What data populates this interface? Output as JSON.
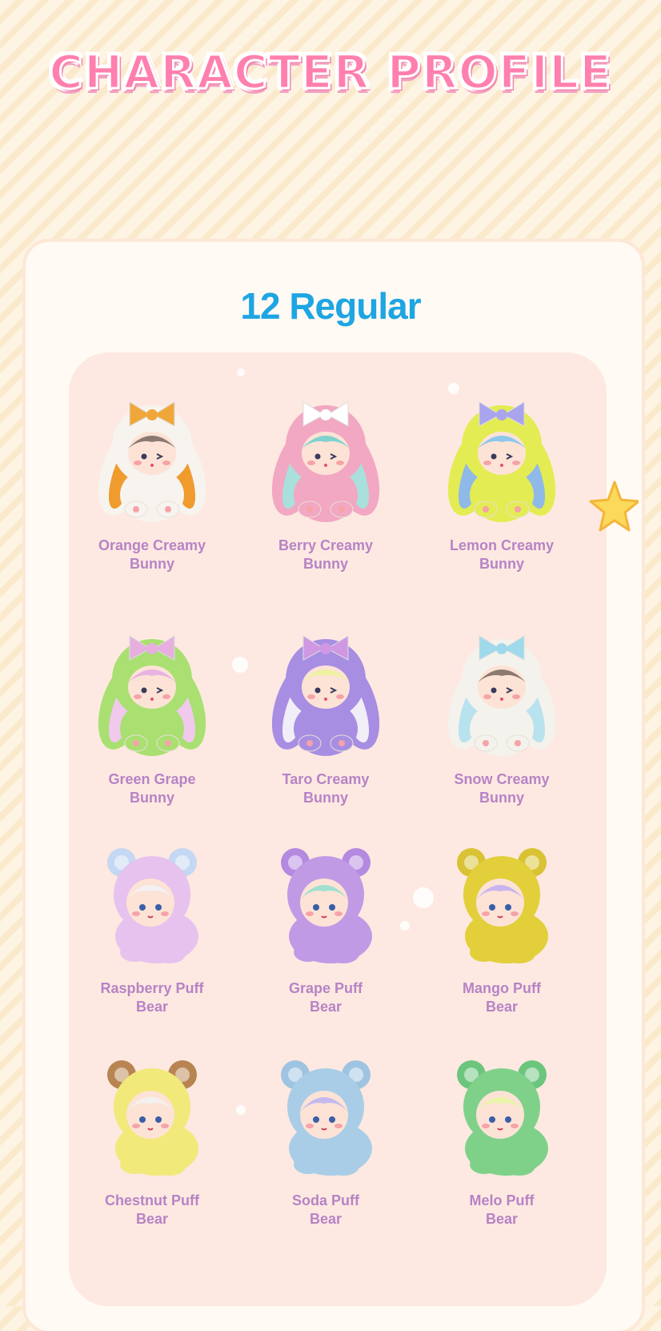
{
  "banner": {
    "title": "CHARACTER PROFILE"
  },
  "section": {
    "title": "12 Regular"
  },
  "characters": [
    {
      "line1": "Orange Creamy",
      "line2": "Bunny",
      "type": "bunny",
      "body": "#f7f4ef",
      "ear": "#ef9b2e",
      "bow": "#f1a63a",
      "hair": "#8c7a70"
    },
    {
      "line1": "Berry Creamy",
      "line2": "Bunny",
      "type": "bunny",
      "body": "#f2a7c2",
      "ear": "#a9e0dc",
      "bow": "#ffffff",
      "hair": "#7fd3cf"
    },
    {
      "line1": "Lemon Creamy",
      "line2": "Bunny",
      "type": "bunny",
      "body": "#e3ec52",
      "ear": "#8fb9e9",
      "bow": "#a9a4ee",
      "hair": "#8cc8ec"
    },
    {
      "line1": "Green Grape",
      "line2": "Bunny",
      "type": "bunny",
      "body": "#a9e071",
      "ear": "#f0c9ec",
      "bow": "#e8aee0",
      "hair": "#e8b3e0"
    },
    {
      "line1": "Taro Creamy",
      "line2": "Bunny",
      "type": "bunny",
      "body": "#a78ee3",
      "ear": "#f1eef8",
      "bow": "#d098e3",
      "hair": "#eef2a0"
    },
    {
      "line1": "Snow Creamy",
      "line2": "Bunny",
      "type": "bunny",
      "body": "#f4f2ec",
      "ear": "#b8e2ee",
      "bow": "#9fd9ec",
      "hair": "#8c7a70"
    },
    {
      "line1": "Raspberry Puff",
      "line2": "Bear",
      "type": "bear",
      "body": "#e7c2ee",
      "ear": "#c4d8f3",
      "bow": "",
      "hair": "#f3f1f4"
    },
    {
      "line1": "Grape Puff",
      "line2": "Bear",
      "type": "bear",
      "body": "#c19ae6",
      "ear": "#b48ae0",
      "bow": "",
      "hair": "#9fe0d0"
    },
    {
      "line1": "Mango Puff",
      "line2": "Bear",
      "type": "bear",
      "body": "#e2cf3a",
      "ear": "#d9c233",
      "bow": "",
      "hair": "#c9b5ee"
    },
    {
      "line1": "Chestnut Puff",
      "line2": "Bear",
      "type": "bear",
      "body": "#f1e97a",
      "ear": "#b78452",
      "bow": "",
      "hair": "#f3f1f0"
    },
    {
      "line1": "Soda Puff",
      "line2": "Bear",
      "type": "bear",
      "body": "#a9cde7",
      "ear": "#9fc4e2",
      "bow": "",
      "hair": "#c6b9ee"
    },
    {
      "line1": "Melo Puff",
      "line2": "Bear",
      "type": "bear",
      "body": "#7fd18a",
      "ear": "#6cc57c",
      "bow": "",
      "hair": "#e9f4a8"
    }
  ]
}
